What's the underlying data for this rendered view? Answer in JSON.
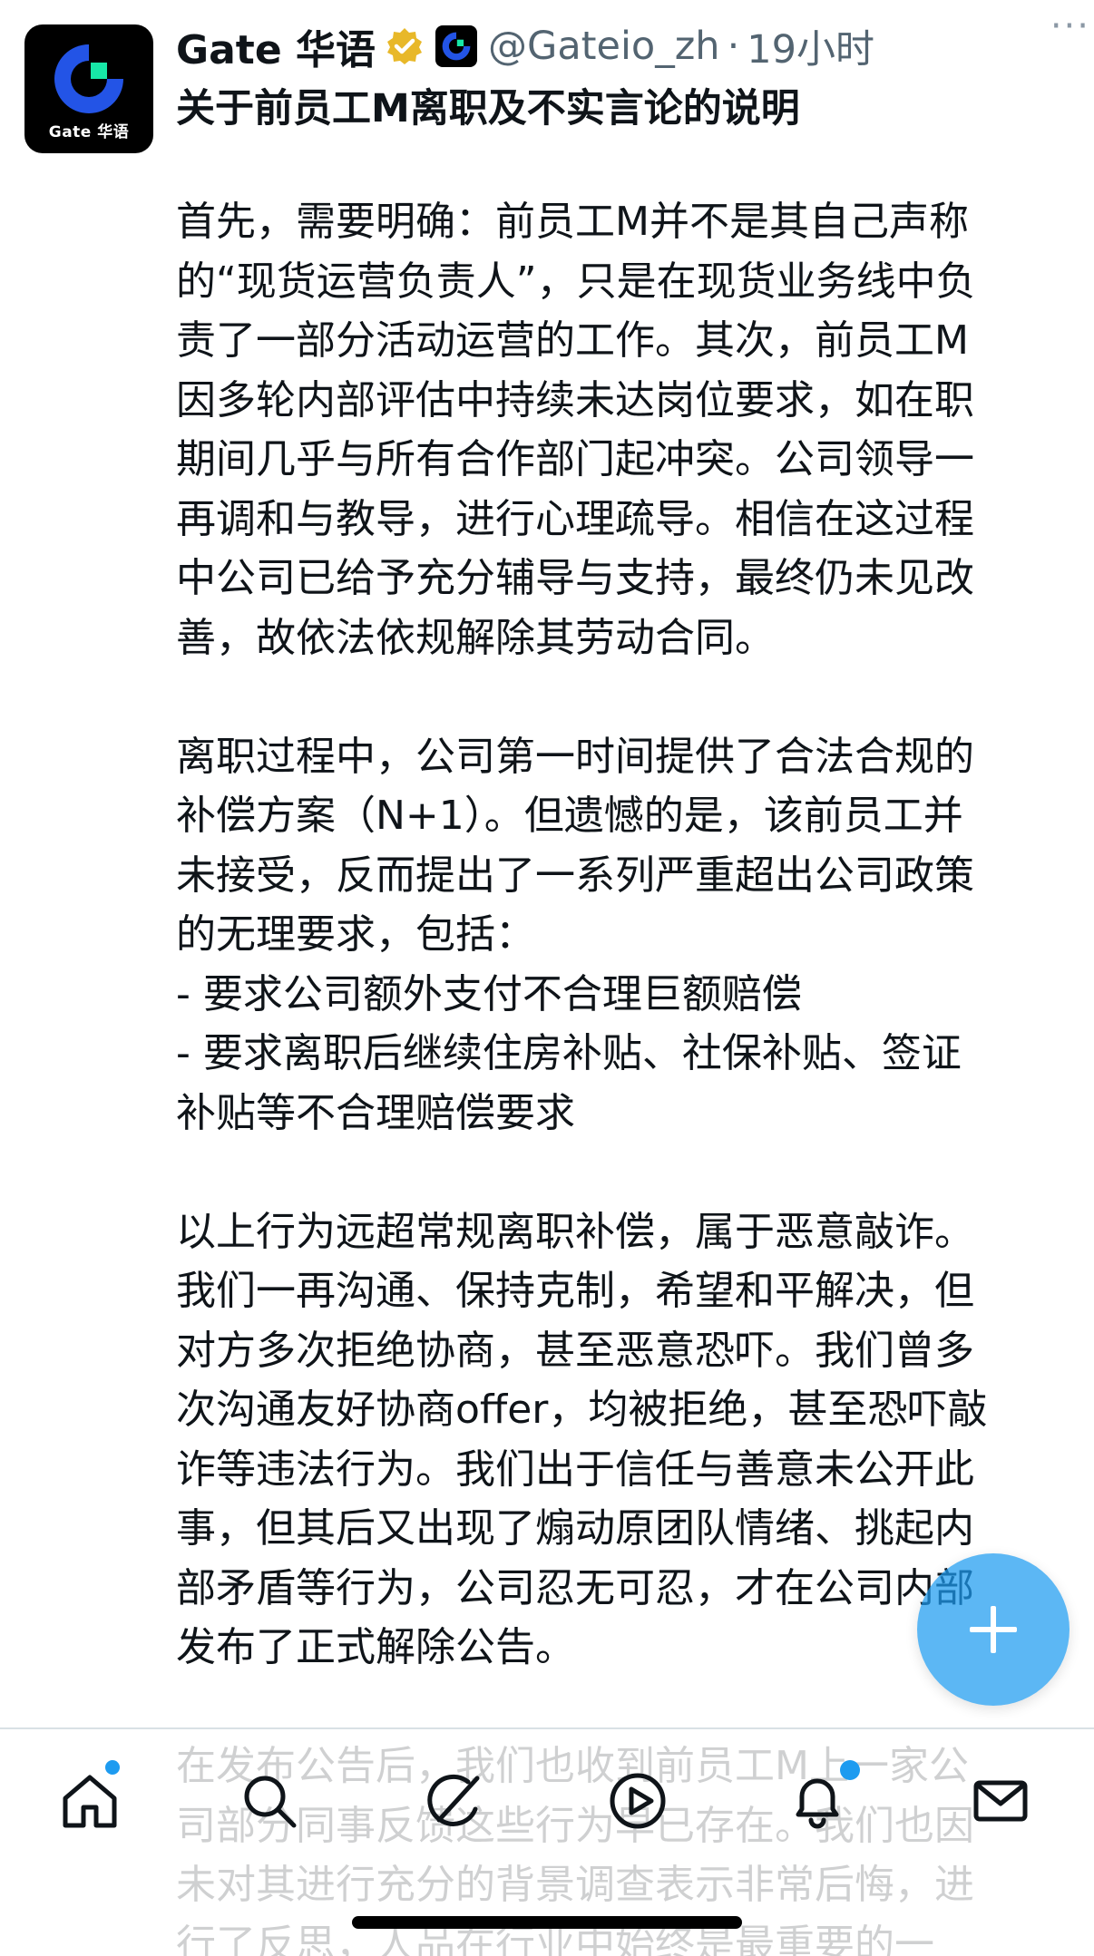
{
  "tweet": {
    "display_name": "Gate 华语",
    "handle": "@Gateio_zh",
    "separator": "·",
    "time": "19小时",
    "more": "···",
    "avatar_text": "Gate 华语",
    "title": "关于前员工M离职及不实言论的说明",
    "body_lines": [
      "首先，需要明确：前员工M并不是其自己声称",
      "的“现货运营负责人”，只是在现货业务线中负",
      "责了一部分活动运营的工作。其次，前员工M",
      "因多轮内部评估中持续未达岗位要求，如在职",
      "期间几乎与所有合作部门起冲突。公司领导一",
      "再调和与教导，进行心理疏导。相信在这过程",
      "中公司已给予充分辅导与支持，最终仍未见改",
      "善，故依法依规解除其劳动合同。",
      "",
      "离职过程中，公司第一时间提供了合法合规的",
      "补偿方案（N+1）。但遗憾的是，该前员工并",
      "未接受，反而提出了一系列严重超出公司政策",
      "的无理要求，包括：",
      "- 要求公司额外支付不合理巨额赔偿",
      "- 要求离职后继续住房补贴、社保补贴、签证",
      "补贴等不合理赔偿要求",
      "",
      "以上行为远超常规离职补偿，属于恶意敲诈。",
      "我们一再沟通、保持克制，希望和平解决，但",
      "对方多次拒绝协商，甚至恶意恐吓。我们曾多",
      "次沟通友好协商offer，均被拒绝，甚至恐吓敲",
      "诈等违法行为。我们出于信任与善意未公开此",
      "事，但其后又出现了煽动原团队情绪、挑起内",
      "部矛盾等行为，公司忍无可忍，才在公司内部",
      "发布了正式解除公告。",
      "",
      "在发布公告后，我们也收到前员工M上一家公",
      "司部分同事反馈这些行为早已存在。我们也因",
      "未对其进行充分的背景调查表示非常后悔，进",
      "行了反思，人品在行业中始终是最重要的一"
    ]
  },
  "nav": {
    "items": [
      "home-icon",
      "search-icon",
      "grok-icon",
      "video-icon",
      "notifications-icon",
      "messages-icon"
    ]
  },
  "colors": {
    "accent": "#1d9bf0",
    "verified_gold": "#e8b829",
    "secondary_text": "#536471"
  }
}
